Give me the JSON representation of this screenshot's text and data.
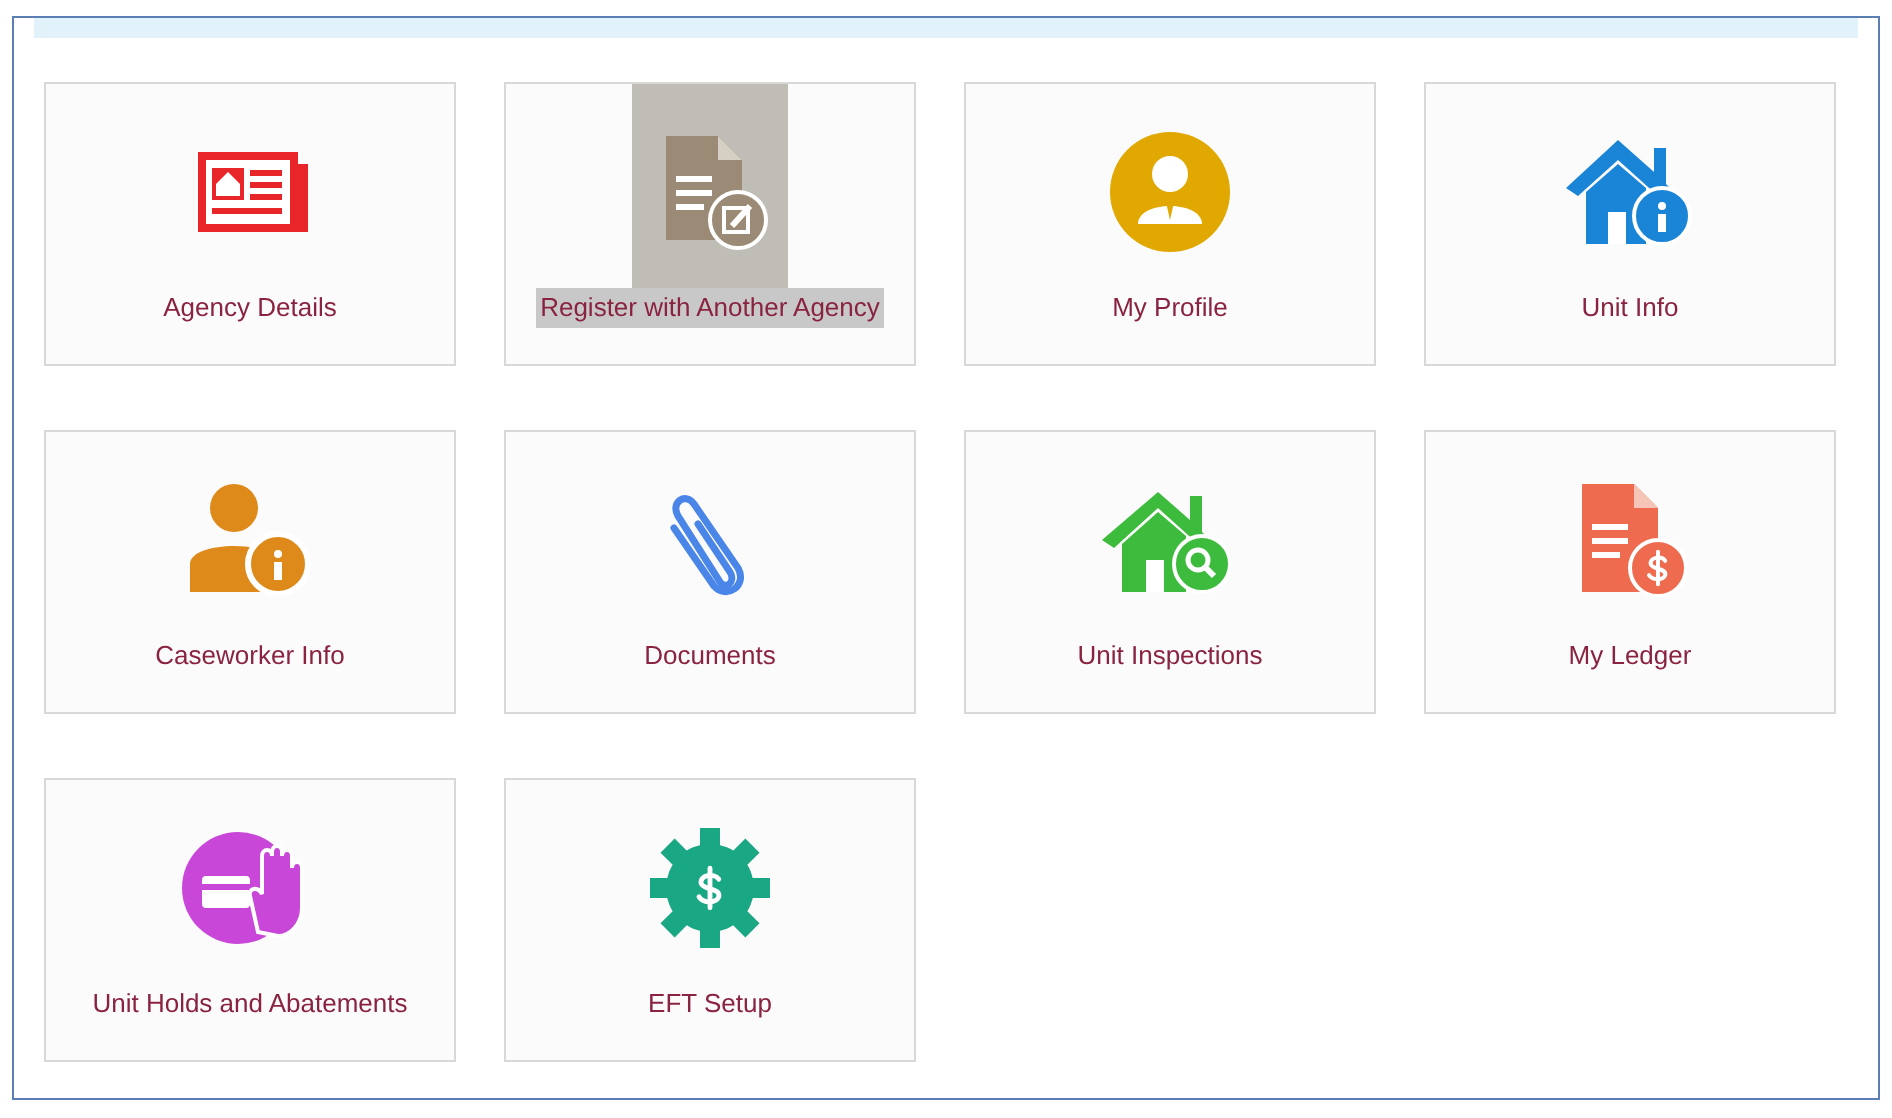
{
  "tiles": [
    {
      "label": "Agency Details",
      "kind": "newspaper",
      "color": "#e8262a",
      "highlighted": false
    },
    {
      "label": "Register with Another Agency",
      "kind": "document-edit",
      "color": "#9a8a76",
      "highlighted": true
    },
    {
      "label": "My Profile",
      "kind": "person-circle",
      "color": "#e0a800",
      "highlighted": false
    },
    {
      "label": "Unit Info",
      "kind": "house-info",
      "color": "#1a85d6",
      "highlighted": false
    },
    {
      "label": "Caseworker Info",
      "kind": "person-info",
      "color": "#de8a1a",
      "highlighted": false
    },
    {
      "label": "Documents",
      "kind": "paperclip",
      "color": "#4a86e8",
      "highlighted": false
    },
    {
      "label": "Unit Inspections",
      "kind": "house-search",
      "color": "#3dbb3d",
      "highlighted": false
    },
    {
      "label": "My Ledger",
      "kind": "document-dollar",
      "color": "#ef6b4f",
      "highlighted": false
    },
    {
      "label": "Unit Holds and Abatements",
      "kind": "hand-circle",
      "color": "#c847d8",
      "highlighted": false
    },
    {
      "label": "EFT Setup",
      "kind": "gear-dollar",
      "color": "#19a784",
      "highlighted": false
    }
  ]
}
